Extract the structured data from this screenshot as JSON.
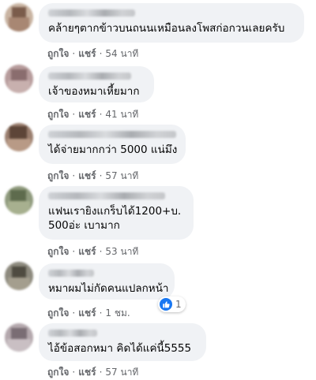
{
  "actions": {
    "like_label": "ถูกใจ",
    "share_label": "แชร์",
    "separator": "·"
  },
  "comments": [
    {
      "text": "คล้ายๆตากข้าวบนถนนเหมือนลงโพสก่อกวนเลยครับ",
      "time": "54 นาที"
    },
    {
      "text": "เจ้าของหมาเหี้ยมาก",
      "time": "41 นาที"
    },
    {
      "text": "ได้จ่ายมากกว่า 5000 แน่มึง",
      "time": "57 นาที"
    },
    {
      "text_line1": "แฟนเรายิงแกร็บได้1200+บ.",
      "text_line2": "500อ่ะ เบามาก",
      "time": "53 นาที"
    },
    {
      "text": "หมาผมไม่กัดคนแปลกหน้า",
      "time": "1 ชม.",
      "reaction_count": "1",
      "reaction_icon": "like-icon"
    },
    {
      "text": "ไอ้ข้อสอกหมา คิดได้แค่นี้5555",
      "time": "57 นาที"
    }
  ]
}
